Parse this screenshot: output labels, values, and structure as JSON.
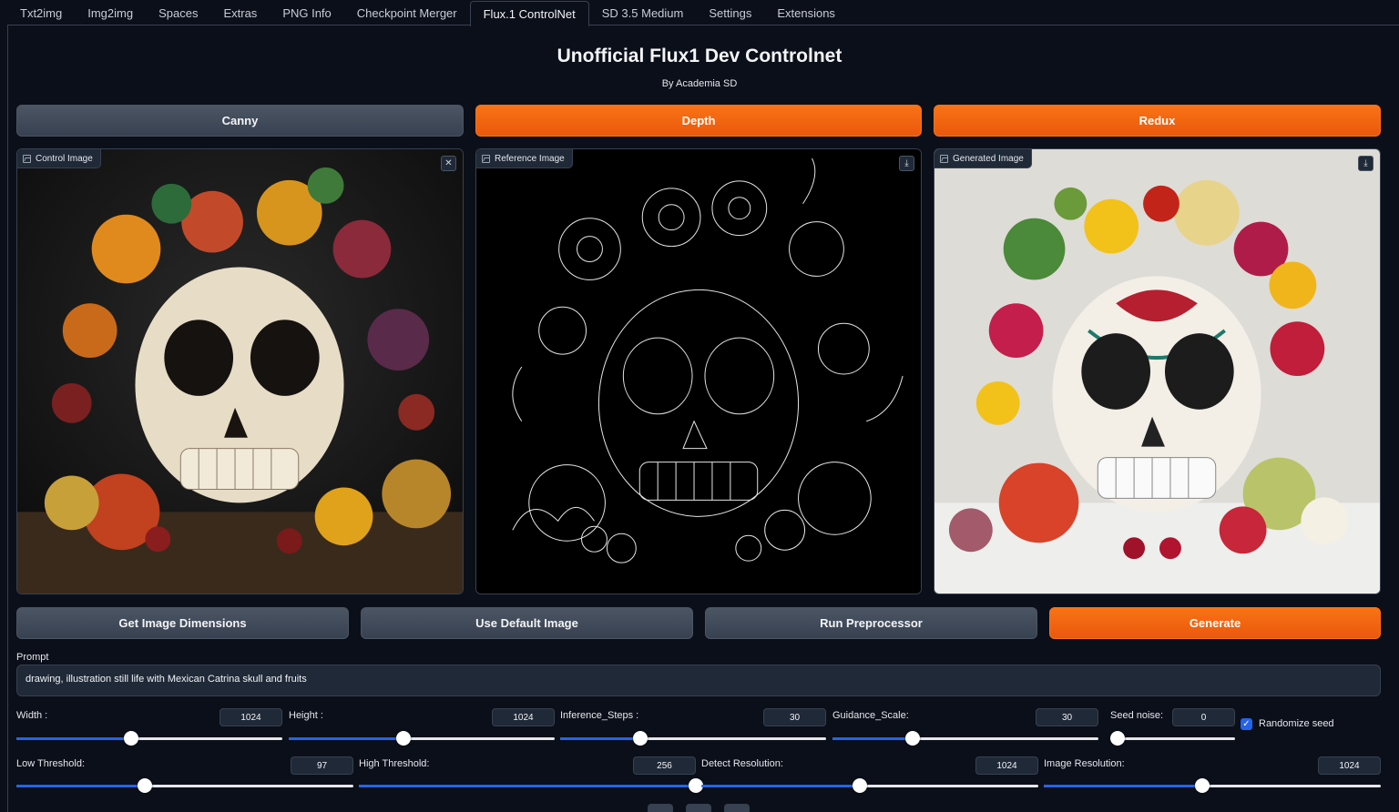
{
  "tabs": [
    "Txt2img",
    "Img2img",
    "Spaces",
    "Extras",
    "PNG Info",
    "Checkpoint Merger",
    "Flux.1 ControlNet",
    "SD 3.5 Medium",
    "Settings",
    "Extensions"
  ],
  "active_tab": "Flux.1 ControlNet",
  "page": {
    "title": "Unofficial Flux1 Dev Controlnet",
    "subtitle": "By Academia SD"
  },
  "mode_buttons": {
    "canny": "Canny",
    "depth": "Depth",
    "redux": "Redux"
  },
  "images": {
    "control": {
      "label": "Control Image"
    },
    "reference": {
      "label": "Reference Image"
    },
    "generated": {
      "label": "Generated Image"
    }
  },
  "actions": {
    "get_dims": "Get Image Dimensions",
    "use_default": "Use Default Image",
    "run_pre": "Run Preprocessor",
    "generate": "Generate"
  },
  "prompt": {
    "label": "Prompt",
    "value": "drawing, illustration still life with Mexican Catrina skull and fruits"
  },
  "params": {
    "width": {
      "label": "Width :",
      "value": "1024",
      "fraction": 0.43
    },
    "height": {
      "label": "Height :",
      "value": "1024",
      "fraction": 0.43
    },
    "steps": {
      "label": "Inference_Steps :",
      "value": "30",
      "fraction": 0.3
    },
    "guidance": {
      "label": "Guidance_Scale:",
      "value": "30",
      "fraction": 0.3
    },
    "seed_noise": {
      "label": "Seed noise:",
      "value": "0",
      "fraction": 0.0
    },
    "randomize": {
      "label": "Randomize seed",
      "checked": true
    },
    "low_thr": {
      "label": "Low Threshold:",
      "value": "97",
      "fraction": 0.38
    },
    "high_thr": {
      "label": "High Threshold:",
      "value": "256",
      "fraction": 1.0
    },
    "detect_res": {
      "label": "Detect Resolution:",
      "value": "1024",
      "fraction": 0.47
    },
    "image_res": {
      "label": "Image Resolution:",
      "value": "1024",
      "fraction": 0.47
    }
  },
  "colors": {
    "accent": "#ea580c",
    "slider": "#2563eb",
    "bg": "#0b0f19"
  },
  "icons": {
    "clear": "close-icon",
    "download": "download-icon",
    "image": "image-icon"
  }
}
